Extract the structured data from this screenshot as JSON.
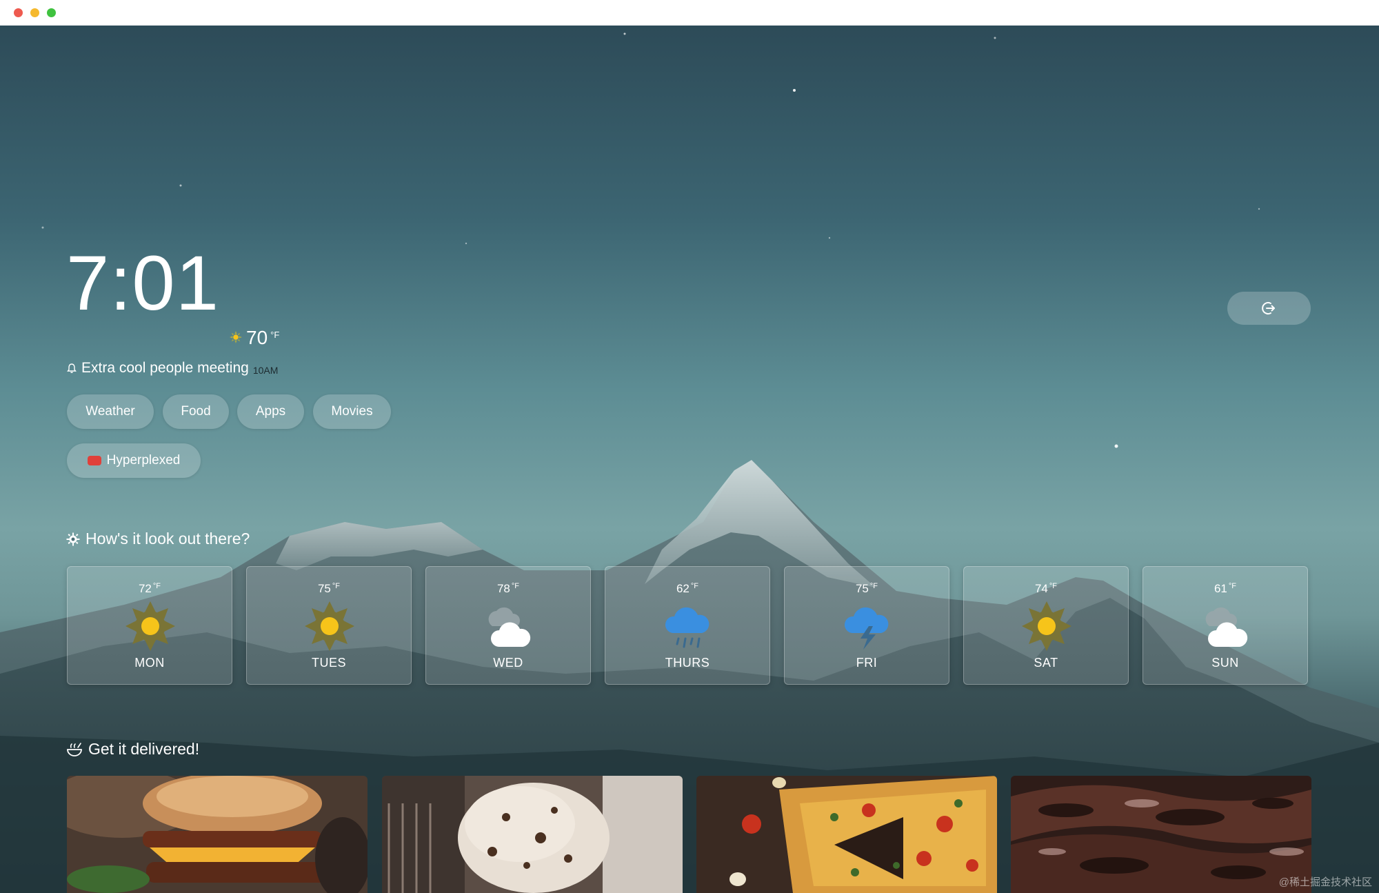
{
  "window": {
    "controls": [
      "close",
      "minimize",
      "zoom"
    ]
  },
  "clock": {
    "time": "7:01",
    "temperature": "70",
    "unit": "°F",
    "condition_icon": "sun-icon"
  },
  "reminder": {
    "icon": "bell-icon",
    "text": "Extra cool people meeting",
    "time": "10AM"
  },
  "nav": {
    "pills": [
      {
        "label": "Weather"
      },
      {
        "label": "Food"
      },
      {
        "label": "Apps"
      },
      {
        "label": "Movies"
      }
    ],
    "channel": {
      "label": "Hyperplexed",
      "icon": "youtube-icon"
    }
  },
  "logout": {
    "icon": "sign-out-icon"
  },
  "weather_section": {
    "title": "How's it look out there?",
    "icon": "gear-sun-icon",
    "days": [
      {
        "day": "MON",
        "temp": "72",
        "unit": "°F",
        "icon": "sun-icon"
      },
      {
        "day": "TUES",
        "temp": "75",
        "unit": "°F",
        "icon": "sun-icon"
      },
      {
        "day": "WED",
        "temp": "78",
        "unit": "°F",
        "icon": "cloud-icon"
      },
      {
        "day": "THURS",
        "temp": "62",
        "unit": "°F",
        "icon": "rain-cloud-icon"
      },
      {
        "day": "FRI",
        "temp": "75",
        "unit": "°F",
        "icon": "storm-cloud-icon"
      },
      {
        "day": "SAT",
        "temp": "74",
        "unit": "°F",
        "icon": "sun-icon"
      },
      {
        "day": "SUN",
        "temp": "61",
        "unit": "°F",
        "icon": "cloud-icon"
      }
    ]
  },
  "food_section": {
    "title": "Get it delivered!",
    "icon": "bowl-icon",
    "items": [
      {
        "name": "burger-image"
      },
      {
        "name": "ice-cream-image"
      },
      {
        "name": "pizza-image"
      },
      {
        "name": "bbq-image"
      }
    ]
  },
  "colors": {
    "sun": "#f6c41a",
    "sun_rays": "#7a7436",
    "rain_cloud": "#3a8fe0",
    "cloud": "#ffffff",
    "youtube": "#e0403a"
  },
  "watermark": "@稀土掘金技术社区"
}
